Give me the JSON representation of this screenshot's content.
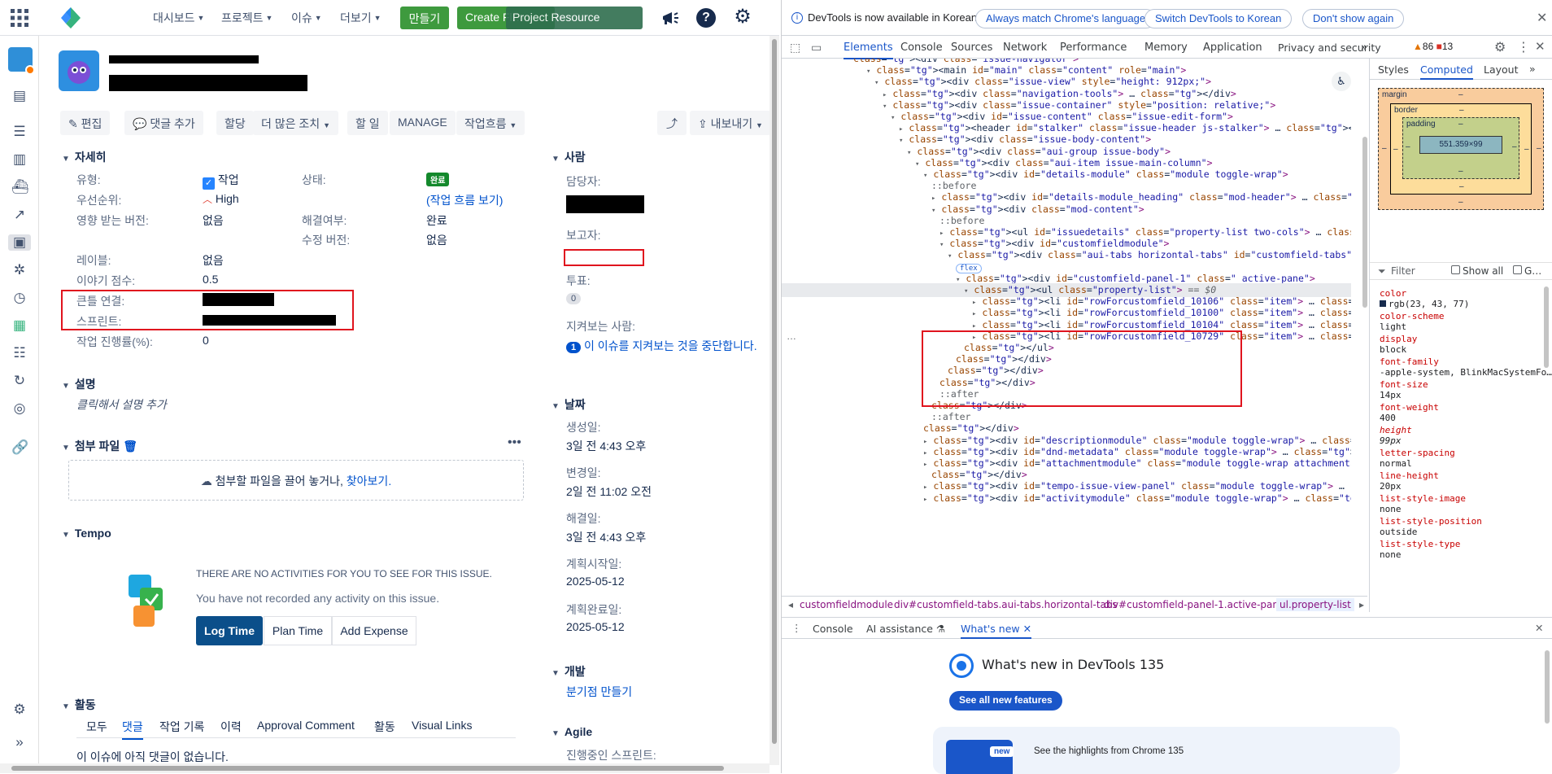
{
  "topnav": {
    "items": [
      "대시보드",
      "프로젝트",
      "이슈",
      "더보기"
    ],
    "create_label": "만들기",
    "create_flow_label": "Create Fl…",
    "resource_label": "Project Resource"
  },
  "issue": {
    "title_redacted": true
  },
  "toolbar": {
    "edit": "편집",
    "comment": "댓글 추가",
    "assign": "할당",
    "more_actions": "더 많은 조치",
    "todo": "할 일",
    "manage": "MANAGE",
    "workflow": "작업흐름",
    "export": "내보내기"
  },
  "details": {
    "heading": "자세히",
    "type_label": "유형:",
    "type_value": "작업",
    "status_label": "상태:",
    "status_value": "완료",
    "priority_label": "우선순위:",
    "priority_value": "High",
    "workflow_link": "(작업 흐름 보기)",
    "affects_label": "영향 받는 버전:",
    "affects_value": "없음",
    "resolution_label": "해결여부:",
    "resolution_value": "완료",
    "fix_label": "수정 버전:",
    "fix_value": "없음",
    "labels_label": "레이블:",
    "labels_value": "없음",
    "story_label": "이야기 점수:",
    "story_value": "0.5",
    "epic_label": "큰틀 연결:",
    "sprint_label": "스프린트:",
    "progress_label": "작업 진행률(%):",
    "progress_value": "0"
  },
  "description": {
    "heading": "설명",
    "placeholder": "클릭해서 설명 추가"
  },
  "attachments": {
    "heading": "첨부 파일",
    "drop_text": "첨부할 파일을 끌어 놓거나,",
    "browse": "찾아보기."
  },
  "tempo": {
    "heading": "Tempo",
    "no_activities": "THERE ARE NO ACTIVITIES FOR YOU TO SEE FOR THIS ISSUE.",
    "not_recorded": "You have not recorded any activity on this issue.",
    "log_time": "Log Time",
    "plan_time": "Plan Time",
    "add_expense": "Add Expense"
  },
  "activity": {
    "heading": "활동",
    "tabs": [
      "모두",
      "댓글",
      "작업 기록",
      "이력",
      "Approval Comment",
      "활동",
      "Visual Links"
    ],
    "no_comments": "이 이슈에 아직 댓글이 없습니다."
  },
  "people": {
    "heading": "사람",
    "assignee_label": "담당자:",
    "reporter_label": "보고자:",
    "votes_label": "투표:",
    "votes_value": "0",
    "watchers_label": "지켜보는 사람:",
    "watchers_count": "1",
    "watchers_link": "이 이슈를 지켜보는 것을 중단합니다."
  },
  "dates": {
    "heading": "날짜",
    "created_label": "생성일:",
    "created_value": "3일 전 4:43 오후",
    "updated_label": "변경일:",
    "updated_value": "2일 전 11:02 오전",
    "resolved_label": "해결일:",
    "resolved_value": "3일 전 4:43 오후",
    "plan_start_label": "계획시작일:",
    "plan_start_value": "2025-05-12",
    "plan_end_label": "계획완료일:",
    "plan_end_value": "2025-05-12"
  },
  "dev": {
    "heading": "개발",
    "create_branch": "분기점 만들기"
  },
  "agile": {
    "heading": "Agile",
    "active_sprint_label": "진행중인 스프린트:"
  },
  "devtools": {
    "info_text": "DevTools is now available in Korean!",
    "always_match": "Always match Chrome's language",
    "switch_korean": "Switch DevTools to Korean",
    "dont_show": "Don't show again",
    "tabs": [
      "Elements",
      "Console",
      "Sources",
      "Network",
      "Performance",
      "Memory",
      "Application",
      "Privacy and security"
    ],
    "warnings": "86",
    "errors": "13",
    "side_tabs": [
      "Styles",
      "Computed",
      "Layout"
    ],
    "box_margin": "margin",
    "box_border": "border",
    "box_padding": "padding",
    "box_content": "551.359×99",
    "dash": "–",
    "filter_placeholder": "Filter",
    "show_all": "Show all",
    "group": "G…",
    "computed_props": [
      {
        "name": "color",
        "value": "rgb(23, 43, 77)"
      },
      {
        "name": "color-scheme",
        "value": "light"
      },
      {
        "name": "display",
        "value": "block"
      },
      {
        "name": "font-family",
        "value": "-apple-system, BlinkMacSystemFo…"
      },
      {
        "name": "font-size",
        "value": "14px"
      },
      {
        "name": "font-weight",
        "value": "400"
      },
      {
        "name": "height",
        "value": "99px"
      },
      {
        "name": "letter-spacing",
        "value": "normal"
      },
      {
        "name": "line-height",
        "value": "20px"
      },
      {
        "name": "list-style-image",
        "value": "none"
      },
      {
        "name": "list-style-position",
        "value": "outside"
      },
      {
        "name": "list-style-type",
        "value": "none"
      }
    ],
    "breadcrumbs": [
      "customfieldmodule",
      "div#customfield-tabs.aui-tabs.horizontal-tabs",
      "div#customfield-panel-1.active-pane",
      "ul.property-list"
    ],
    "drawer_tabs": [
      "Console",
      "AI assistance",
      "What's new"
    ],
    "whats_new_title": "What's new in DevTools 135",
    "see_all": "See all new features",
    "new_badge": "new",
    "highlights": "See the highlights from Chrome 135",
    "code_lines": [
      "<div class=\"issue-navigator\">",
      "<main id=\"main\" class=\"content\" role=\"main\">",
      "<div class=\"issue-view\" style=\"height: 912px;\">",
      "<div class=\"navigation-tools\"> … </div>",
      "<div class=\"issue-container\" style=\"position: relative;\">",
      "<div id=\"issue-content\" class=\"issue-edit-form\">",
      "<header id=\"stalker\" class=\"issue-header js-stalker\"> … </header>",
      "<div class=\"issue-body-content\">",
      "<div class=\"aui-group issue-body\">",
      "<div class=\"aui-item issue-main-column\">",
      "<div id=\"details-module\" class=\"module toggle-wrap\">",
      "::before",
      "<div id=\"details-module_heading\" class=\"mod-header\"> … </div>",
      "<div class=\"mod-content\">",
      "::before",
      "<ul id=\"issuedetails\" class=\"property-list two-cols\"> … </ul>",
      "<div id=\"customfieldmodule\">",
      "<div class=\"aui-tabs horizontal-tabs\" id=\"customfield-tabs\" role=\"application\">",
      "flex",
      "<div id=\"customfield-panel-1\" class=\" active-pane\">",
      "<ul class=\"property-list\"> == $0",
      "<li id=\"rowForcustomfield_10106\" class=\"item\"> … </li>",
      "<li id=\"rowForcustomfield_10100\" class=\"item\"> … </li>",
      "<li id=\"rowForcustomfield_10104\" class=\"item\"> … </li>",
      "<li id=\"rowForcustomfield_10729\" class=\"item\"> … </li>",
      "</ul>",
      "</div>",
      "</div>",
      "</div>",
      "::after",
      "</div>",
      "::after",
      "</div>",
      "<div id=\"descriptionmodule\" class=\"module toggle-wrap\"> … </div>",
      "<div id=\"dnd-metadata\" class=\"module toggle-wrap\"> … </div>",
      "<div id=\"attachmentmodule\" class=\"module toggle-wrap attachments-drop-zone-parent\"> …",
      "</div>",
      "<div id=\"tempo-issue-view-panel\" class=\"module toggle-wrap\"> … </div>",
      "<div id=\"activitymodule\" class=\"module toggle-wrap\"> … </div>"
    ]
  }
}
